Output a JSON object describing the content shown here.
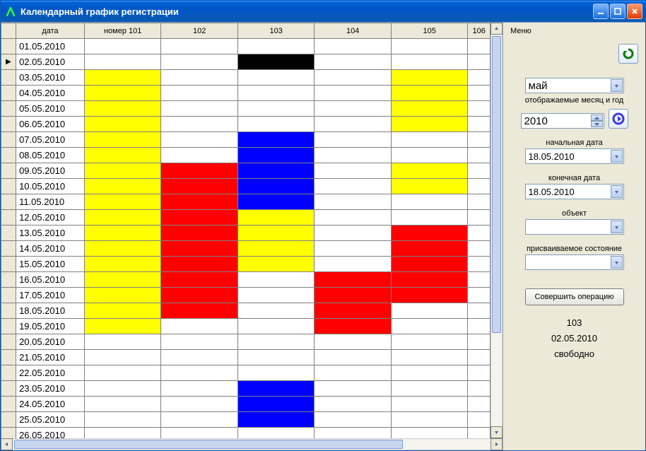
{
  "window": {
    "title": "Календарный график регистрации"
  },
  "grid": {
    "columns": [
      "дата",
      "номер 101",
      "102",
      "103",
      "104",
      "105",
      "106"
    ],
    "rows": [
      {
        "date": "01.05.2010",
        "cells": [
          "",
          "",
          "",
          "",
          "",
          ""
        ]
      },
      {
        "date": "02.05.2010",
        "cells": [
          "",
          "",
          "black",
          "",
          "",
          ""
        ],
        "current": true
      },
      {
        "date": "03.05.2010",
        "cells": [
          "yellow",
          "",
          "",
          "",
          "yellow",
          ""
        ]
      },
      {
        "date": "04.05.2010",
        "cells": [
          "yellow",
          "",
          "",
          "",
          "yellow",
          ""
        ]
      },
      {
        "date": "05.05.2010",
        "cells": [
          "yellow",
          "",
          "",
          "",
          "yellow",
          ""
        ]
      },
      {
        "date": "06.05.2010",
        "cells": [
          "yellow",
          "",
          "",
          "",
          "yellow",
          ""
        ]
      },
      {
        "date": "07.05.2010",
        "cells": [
          "yellow",
          "",
          "blue",
          "",
          "",
          ""
        ]
      },
      {
        "date": "08.05.2010",
        "cells": [
          "yellow",
          "",
          "blue",
          "",
          "",
          ""
        ]
      },
      {
        "date": "09.05.2010",
        "cells": [
          "yellow",
          "red",
          "blue",
          "",
          "yellow",
          ""
        ]
      },
      {
        "date": "10.05.2010",
        "cells": [
          "yellow",
          "red",
          "blue",
          "",
          "yellow",
          ""
        ]
      },
      {
        "date": "11.05.2010",
        "cells": [
          "yellow",
          "red",
          "blue",
          "",
          "",
          ""
        ]
      },
      {
        "date": "12.05.2010",
        "cells": [
          "yellow",
          "red",
          "yellow",
          "",
          "",
          ""
        ]
      },
      {
        "date": "13.05.2010",
        "cells": [
          "yellow",
          "red",
          "yellow",
          "",
          "red",
          ""
        ]
      },
      {
        "date": "14.05.2010",
        "cells": [
          "yellow",
          "red",
          "yellow",
          "",
          "red",
          ""
        ]
      },
      {
        "date": "15.05.2010",
        "cells": [
          "yellow",
          "red",
          "yellow",
          "",
          "red",
          ""
        ]
      },
      {
        "date": "16.05.2010",
        "cells": [
          "yellow",
          "red",
          "",
          "red",
          "red",
          ""
        ]
      },
      {
        "date": "17.05.2010",
        "cells": [
          "yellow",
          "red",
          "",
          "red",
          "red",
          ""
        ]
      },
      {
        "date": "18.05.2010",
        "cells": [
          "yellow",
          "red",
          "",
          "red",
          "",
          ""
        ]
      },
      {
        "date": "19.05.2010",
        "cells": [
          "yellow",
          "",
          "",
          "red",
          "",
          ""
        ]
      },
      {
        "date": "20.05.2010",
        "cells": [
          "",
          "",
          "",
          "",
          "",
          ""
        ]
      },
      {
        "date": "21.05.2010",
        "cells": [
          "",
          "",
          "",
          "",
          "",
          ""
        ]
      },
      {
        "date": "22.05.2010",
        "cells": [
          "",
          "",
          "",
          "",
          "",
          ""
        ]
      },
      {
        "date": "23.05.2010",
        "cells": [
          "",
          "",
          "blue",
          "",
          "",
          ""
        ]
      },
      {
        "date": "24.05.2010",
        "cells": [
          "",
          "",
          "blue",
          "",
          "",
          ""
        ]
      },
      {
        "date": "25.05.2010",
        "cells": [
          "",
          "",
          "blue",
          "",
          "",
          ""
        ]
      },
      {
        "date": "26.05.2010",
        "cells": [
          "",
          "",
          "",
          "",
          "",
          ""
        ]
      }
    ]
  },
  "side": {
    "menu": "Меню",
    "month_value": "май",
    "month_year_label": "отображаемые месяц и год",
    "year_value": "2010",
    "start_date_label": "начальная дата",
    "start_date_value": "18.05.2010",
    "end_date_label": "конечная дата",
    "end_date_value": "18.05.2010",
    "object_label": "объект",
    "object_value": "",
    "state_label": "присваиваемое состояние",
    "state_value": "",
    "action_button": "Совершить операцию",
    "status_room": "103",
    "status_date": "02.05.2010",
    "status_state": "свободно"
  }
}
